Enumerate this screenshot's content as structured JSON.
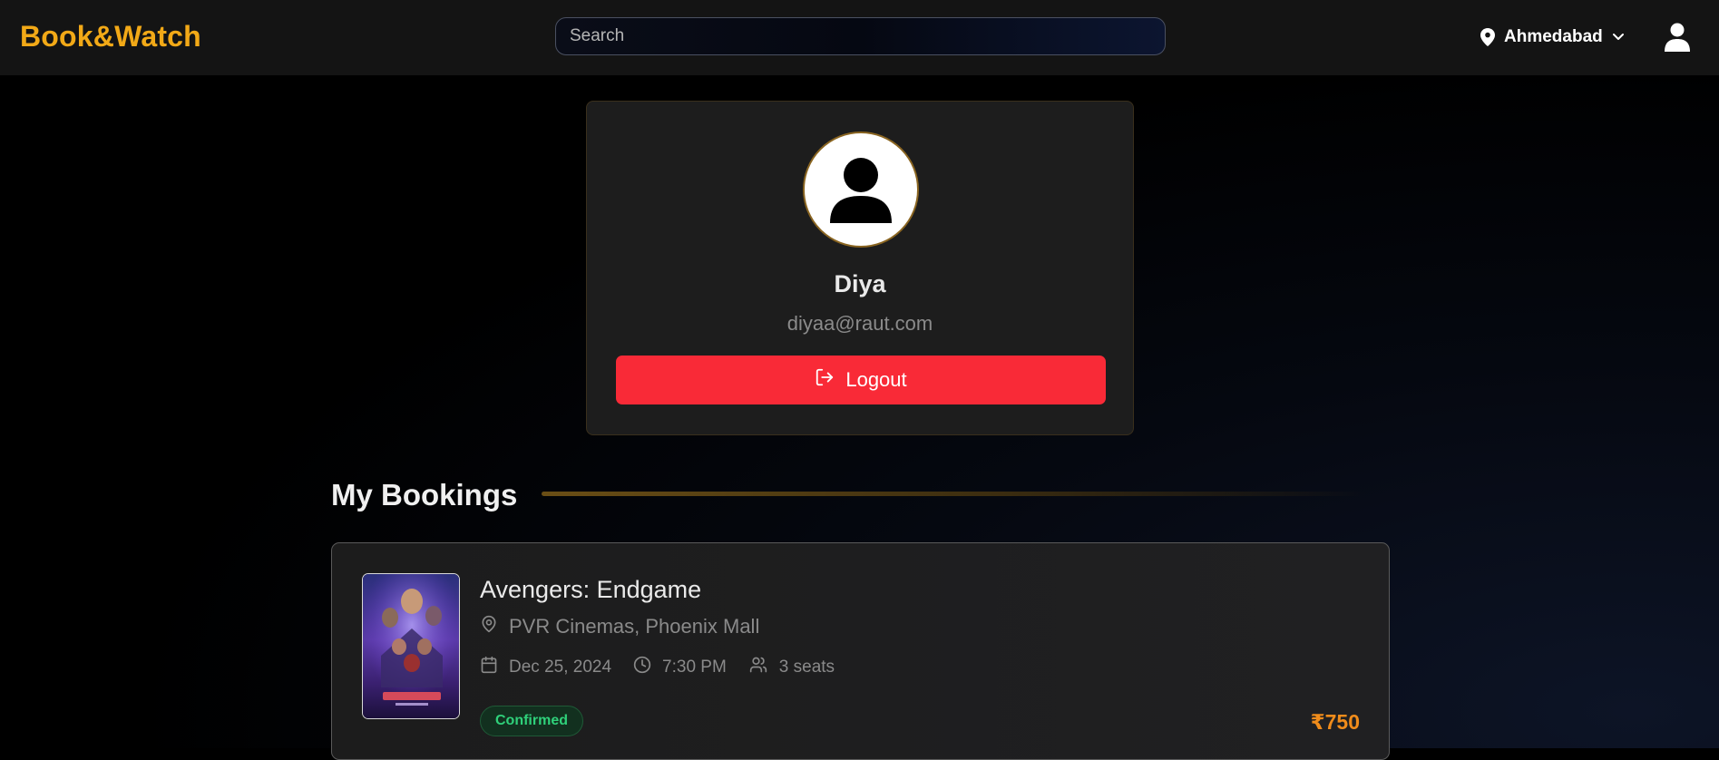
{
  "header": {
    "logo": "Book&Watch",
    "search_placeholder": "Search",
    "location": "Ahmedabad"
  },
  "profile": {
    "name": "Diya",
    "email": "diyaa@raut.com",
    "logout_label": "Logout"
  },
  "bookings": {
    "title": "My Bookings",
    "items": [
      {
        "movie": "Avengers: Endgame",
        "theatre": "PVR Cinemas, Phoenix Mall",
        "date": "Dec 25, 2024",
        "time": "7:30 PM",
        "seats": "3 seats",
        "status": "Confirmed",
        "price": "₹750"
      }
    ]
  },
  "colors": {
    "brand": "#f2a917",
    "logout": "#f92a37",
    "status_confirmed": "#2fd07a",
    "price": "#f08c1b"
  },
  "icons": [
    "map-pin-icon",
    "chevron-down-icon",
    "user-icon",
    "logout-icon",
    "calendar-icon",
    "clock-icon",
    "users-icon"
  ]
}
